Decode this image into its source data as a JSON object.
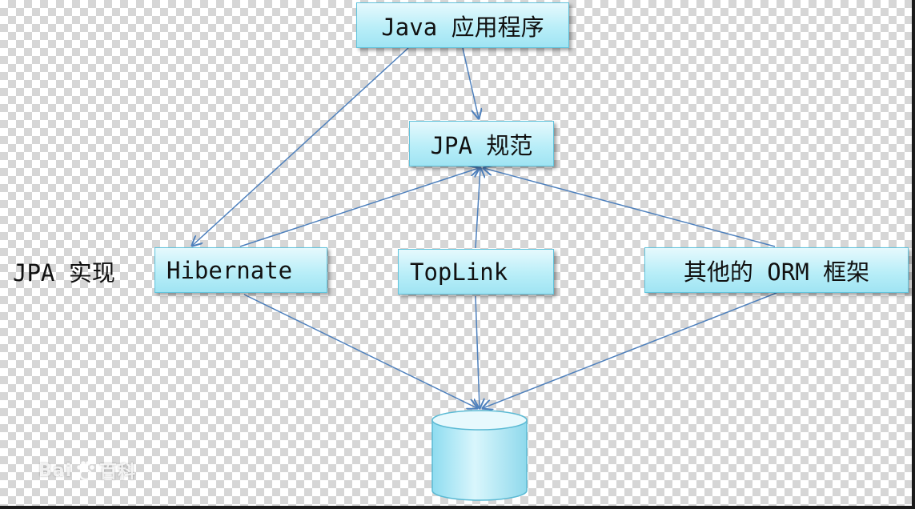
{
  "diagram": {
    "nodes": {
      "java_app": "Java 应用程序",
      "jpa_spec": "JPA 规范",
      "hibernate": "Hibernate",
      "toplink": "TopLink",
      "other_orm": "其他的 ORM 框架"
    },
    "side_label": "JPA 实现",
    "database_icon": "database-cylinder-icon"
  },
  "watermark": {
    "left_text": "Bai",
    "right_text": "百科",
    "icon": "baidu-paw-icon"
  },
  "colors": {
    "node_fill": "#b9eef8",
    "node_border": "#62c3dc",
    "connector": "#4f81bd"
  }
}
